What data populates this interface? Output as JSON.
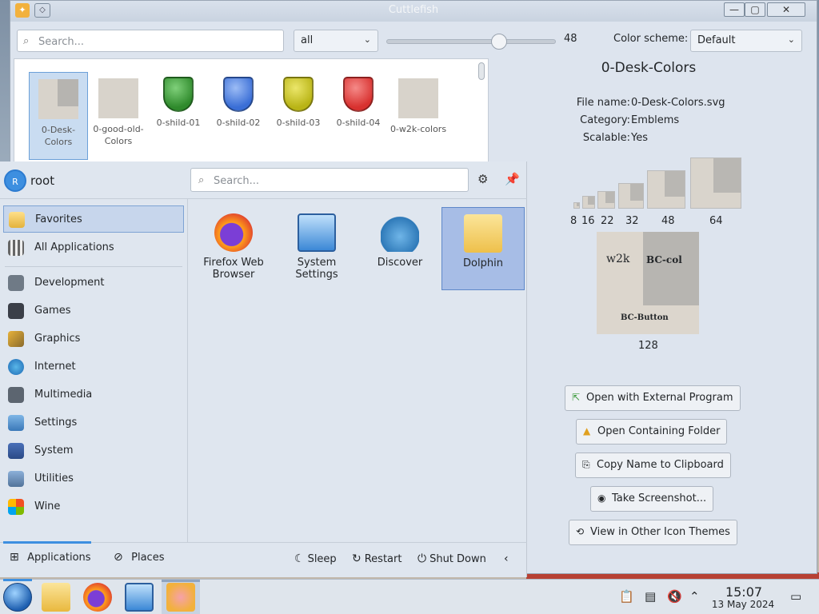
{
  "window": {
    "title": "Cuttlefish",
    "search_placeholder": "Search...",
    "filter_value": "all",
    "size_value": "48",
    "slider_fraction": 0.66,
    "color_scheme_label": "Color scheme:",
    "color_scheme_value": "Default",
    "icons": [
      {
        "label": "0-Desk-Colors",
        "selected": true
      },
      {
        "label": "0-good-old-Colors"
      },
      {
        "label": "0-shild-01",
        "color": "#2f8a2c"
      },
      {
        "label": "0-shild-02",
        "color": "#3a6ed6"
      },
      {
        "label": "0-shild-03",
        "color": "#b9b416"
      },
      {
        "label": "0-shild-04",
        "color": "#d8312f"
      },
      {
        "label": "0-w2k-colors"
      }
    ],
    "detail": {
      "title": "0-Desk-Colors",
      "file_name_key": "File name:",
      "file_name": "0-Desk-Colors.svg",
      "category_key": "Category:",
      "category": "Emblems",
      "scalable_key": "Scalable:",
      "scalable": "Yes",
      "sizes": [
        "8",
        "16",
        "22",
        "32",
        "48",
        "64"
      ],
      "big_size": "128",
      "preview_texts": {
        "w2k": "w2k",
        "bccol": "BC-col",
        "bcbutton": "BC-Button"
      },
      "buttons": [
        "Open with External Program",
        "Open Containing Folder",
        "Copy Name to Clipboard",
        "Take Screenshot...",
        "View in Other Icon Themes"
      ]
    }
  },
  "launcher": {
    "user": "root",
    "avatar_letter": "R",
    "search_placeholder": "Search...",
    "categories_top": [
      {
        "label": "Favorites",
        "selected": true
      },
      {
        "label": "All Applications"
      }
    ],
    "categories": [
      "Development",
      "Games",
      "Graphics",
      "Internet",
      "Multimedia",
      "Settings",
      "System",
      "Utilities",
      "Wine"
    ],
    "apps": [
      {
        "label": "Firefox Web Browser"
      },
      {
        "label": "System Settings"
      },
      {
        "label": "Discover"
      },
      {
        "label": "Dolphin",
        "selected": true
      }
    ],
    "footer": {
      "applications": "Applications",
      "places": "Places",
      "sleep": "Sleep",
      "restart": "Restart",
      "shutdown": "Shut Down"
    }
  },
  "taskbar": {
    "time": "15:07",
    "date": "13 May 2024"
  }
}
